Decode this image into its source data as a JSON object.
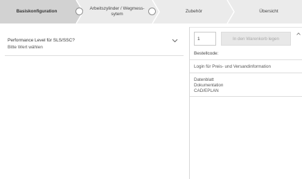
{
  "stepper": {
    "steps": [
      {
        "label": "Basiskonfiguration",
        "active": true
      },
      {
        "label": "Arbeitszylinder / Wegmess-\nsytem",
        "active": false
      },
      {
        "label": "Zubehör",
        "active": false
      },
      {
        "label": "Übersicht",
        "active": false
      }
    ],
    "colors": {
      "active_bg": "#d2d2d2",
      "inactive_bg": "#ebebeb",
      "separator": "#ffffff"
    }
  },
  "config": {
    "title": "Performance Level für SLS/SSC?",
    "value": "Bitte Wert wählen",
    "chevron_icon": "chevron-down-icon"
  },
  "panel": {
    "quantity": "1",
    "add_to_cart_label": "In den Warenkorb legen",
    "order_code_label": "Bestellcode:",
    "login_link": "Login für Preis- und Versandinformation",
    "doc_links": [
      "Datenblatt",
      "Dokumentation",
      "CAD/EPLAN"
    ],
    "collapse_icon": "chevron-up-icon"
  }
}
